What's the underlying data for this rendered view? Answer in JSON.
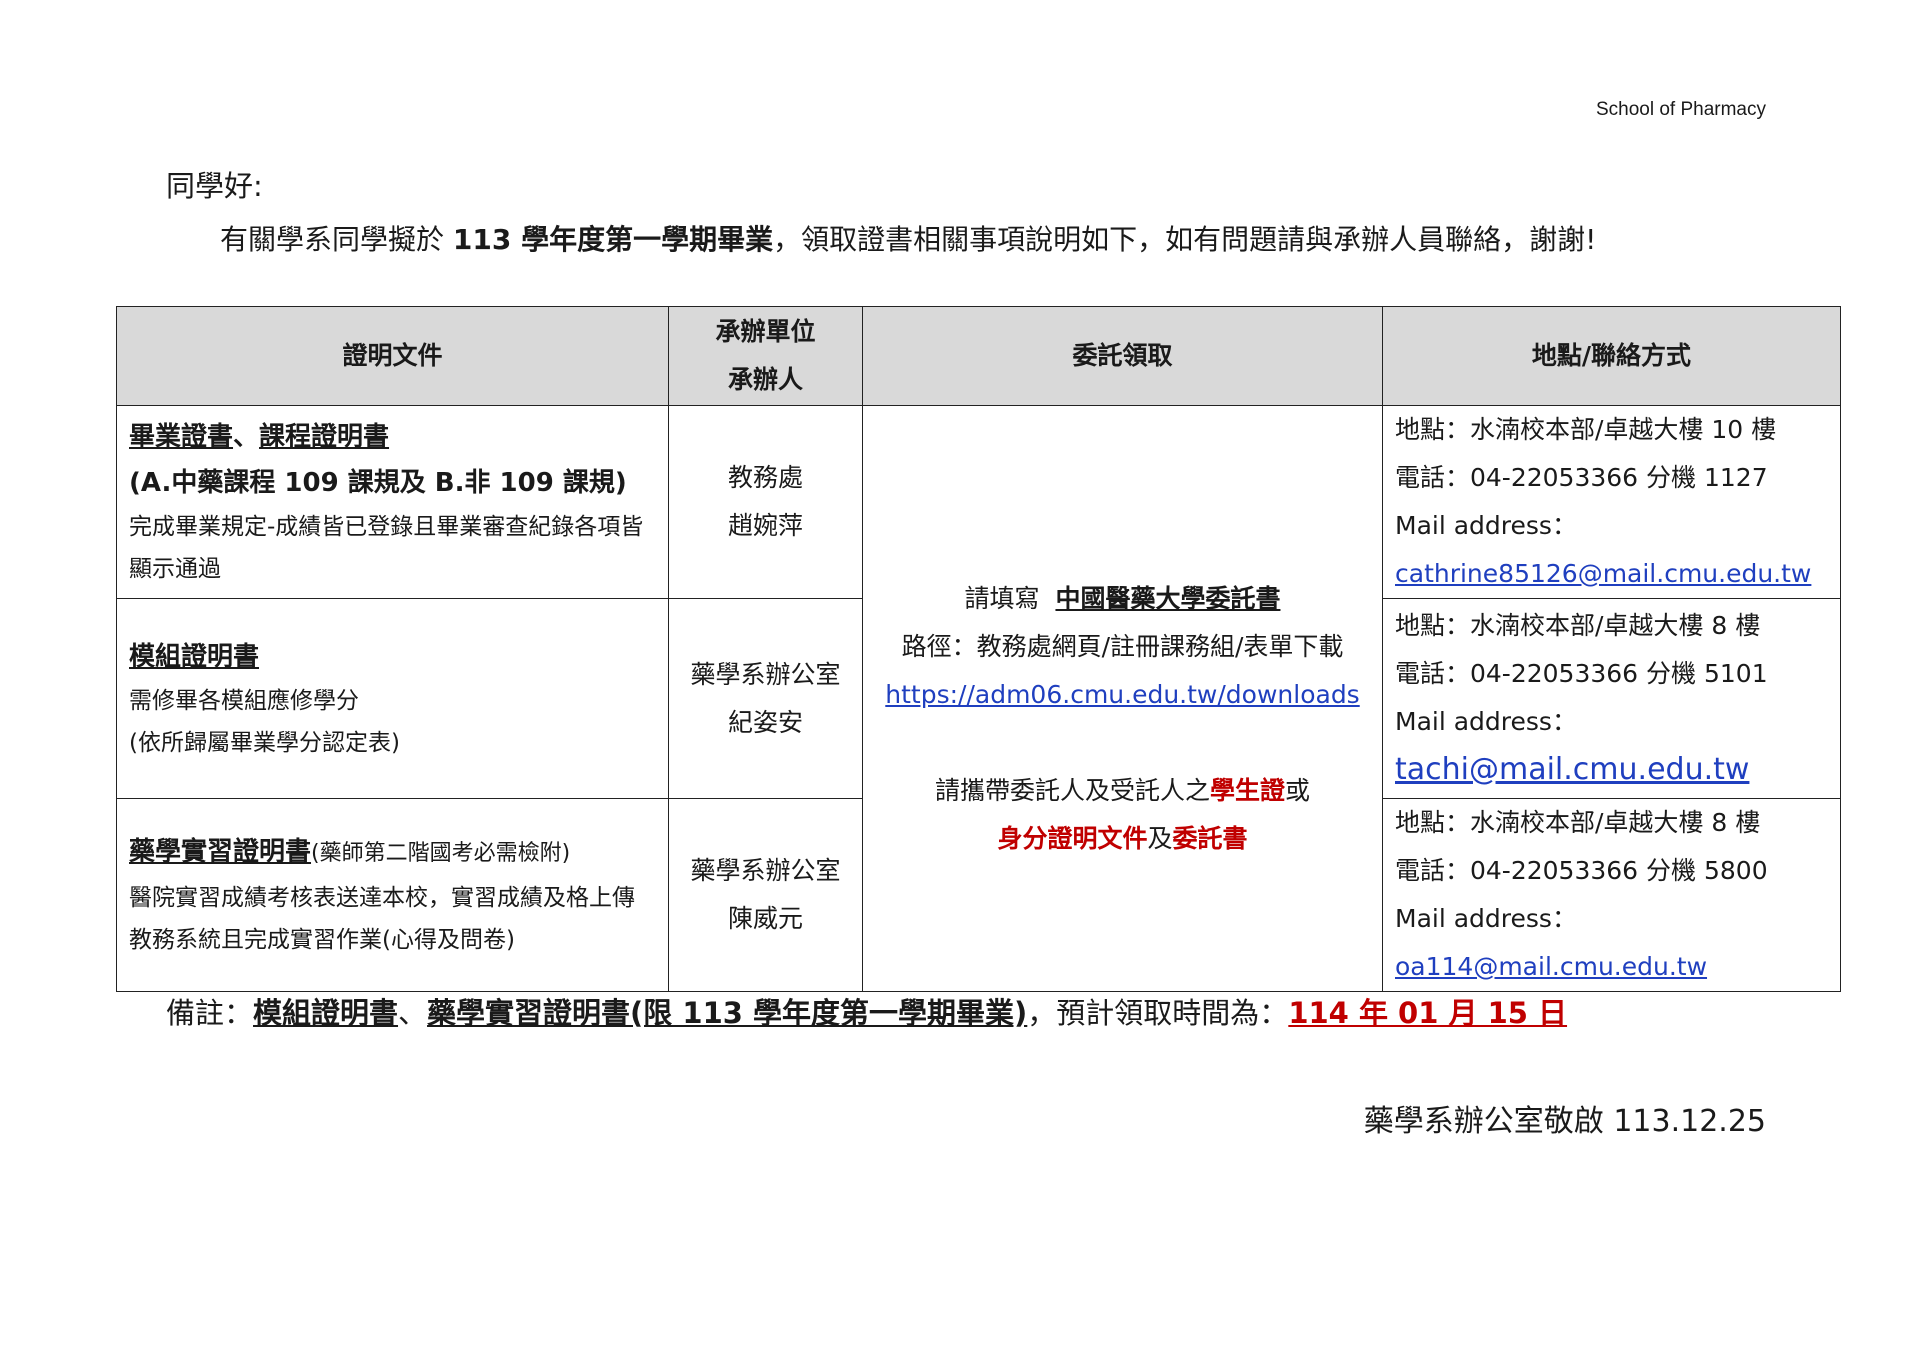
{
  "header": {
    "school": "School of Pharmacy"
  },
  "greeting": "同學好:",
  "intro": {
    "pre": "有關學系同學擬於 ",
    "bold": "113 學年度第一學期畢業",
    "post": "，領取證書相關事項說明如下，如有問題請與承辦人員聯絡，謝謝!"
  },
  "table": {
    "headers": {
      "doc": "證明文件",
      "unit_line1": "承辦單位",
      "unit_line2": "承辦人",
      "delegate": "委託領取",
      "contact": "地點/聯絡方式"
    },
    "rows": [
      {
        "title": "畢業證書",
        "sep": "、",
        "title2": "課程證明書",
        "subtitle": "(A.中藥課程 109 課規及 B.非 109 課規)",
        "desc": "完成畢業規定-成績皆已登錄且畢業審查紀錄各項皆顯示通過",
        "unit": "教務處",
        "person": "趙婉萍",
        "location": "地點：水湳校本部/卓越大樓 10 樓",
        "phone": "電話：04-22053366 分機 1127",
        "mail_label": "Mail address：",
        "email": "cathrine85126@mail.cmu.edu.tw"
      },
      {
        "title": "模組證明書",
        "desc1": "需修畢各模組應修學分",
        "desc2": "(依所歸屬畢業學分認定表)",
        "unit": "藥學系辦公室",
        "person": "紀姿安",
        "location": "地點：水湳校本部/卓越大樓 8 樓",
        "phone": "電話：04-22053366 分機 5101",
        "mail_label": "Mail address：",
        "email": "tachi@mail.cmu.edu.tw"
      },
      {
        "title": "藥學實習證明書",
        "note": "(藥師第二階國考必需檢附)",
        "desc": "醫院實習成績考核表送達本校，實習成績及格上傳教務系統且完成實習作業(心得及問卷)",
        "unit": "藥學系辦公室",
        "person": "陳威元",
        "location": "地點：水湳校本部/卓越大樓 8 樓",
        "phone": "電話：04-22053366 分機 5800",
        "mail_label": "Mail address：",
        "email": "oa114@mail.cmu.edu.tw"
      }
    ],
    "delegate": {
      "fill_prefix": "請填寫",
      "fill_title": "中國醫藥大學委託書",
      "path": "路徑：教務處網頁/註冊課務組/表單下載",
      "url": "https://adm06.cmu.edu.tw/downloads",
      "bring_prefix": "請攜帶委託人及受託人之",
      "student_id": "學生證",
      "or": "或",
      "id_doc": "身分證明文件",
      "and": "及",
      "letter": "委託書"
    }
  },
  "remark": {
    "label": "備註：",
    "item1": "模組證明書",
    "sep": "、",
    "item2": "藥學實習證明書(限 113 學年度第一學期畢業)",
    "mid": "，預計領取時間為：",
    "date": "114 年 01 月 15 日"
  },
  "signoff": "藥學系辦公室敬啟 113.12.25"
}
